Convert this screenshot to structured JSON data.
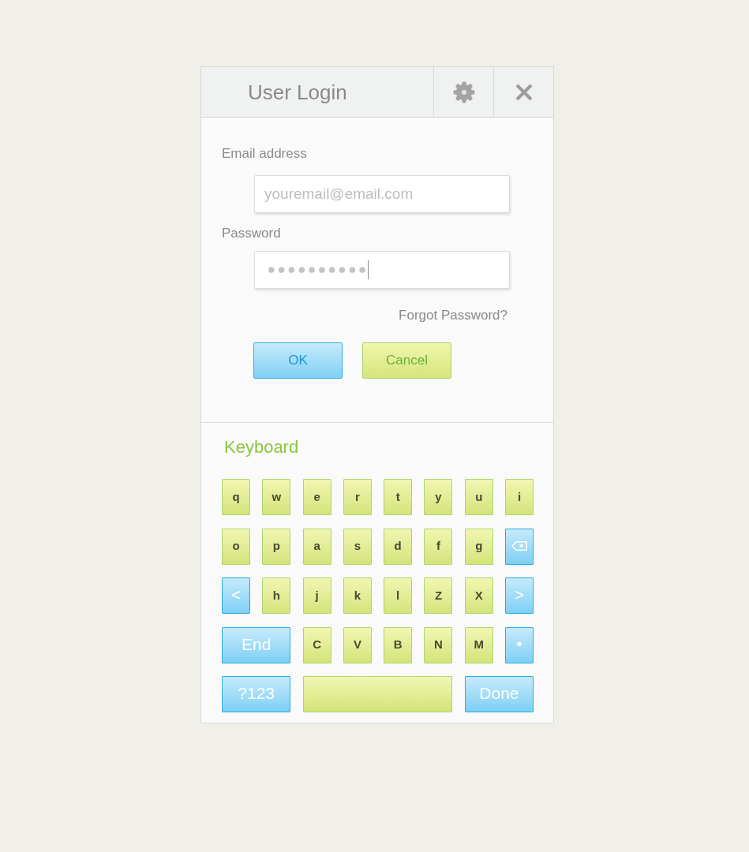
{
  "window": {
    "title": "User Login"
  },
  "form": {
    "email": {
      "label": "Email address",
      "placeholder": "youremail@email.com"
    },
    "password": {
      "label": "Password",
      "value": "••••••••••",
      "focused": true
    },
    "forgot_link": "Forgot Password?",
    "buttons": [
      {
        "label": "OK",
        "kind": "primary"
      },
      {
        "label": "Cancel",
        "kind": "secondary"
      }
    ]
  },
  "keyboard": {
    "title": "Keyboard",
    "keys": [
      {
        "label": "q",
        "kind": "letter"
      },
      {
        "label": "w",
        "kind": "letter"
      },
      {
        "label": "e",
        "kind": "letter"
      },
      {
        "label": "r",
        "kind": "letter"
      },
      {
        "label": "t",
        "kind": "letter"
      },
      {
        "label": "y",
        "kind": "letter"
      },
      {
        "label": "u",
        "kind": "letter"
      },
      {
        "label": "i",
        "kind": "letter"
      },
      {
        "label": "o",
        "kind": "letter"
      },
      {
        "label": "p",
        "kind": "letter"
      },
      {
        "label": "a",
        "kind": "letter"
      },
      {
        "label": "s",
        "kind": "letter"
      },
      {
        "label": "d",
        "kind": "letter"
      },
      {
        "label": "f",
        "kind": "letter"
      },
      {
        "label": "g",
        "kind": "letter"
      },
      {
        "kind": "backspace"
      },
      {
        "label": "<",
        "kind": "nav"
      },
      {
        "label": "h",
        "kind": "letter"
      },
      {
        "label": "j",
        "kind": "letter"
      },
      {
        "label": "k",
        "kind": "letter"
      },
      {
        "label": "l",
        "kind": "letter"
      },
      {
        "label": "Z",
        "kind": "letter"
      },
      {
        "label": "X",
        "kind": "letter"
      },
      {
        "label": ">",
        "kind": "nav"
      },
      {
        "label": "End",
        "kind": "wide"
      },
      {
        "label": "C",
        "kind": "letter"
      },
      {
        "label": "V",
        "kind": "letter"
      },
      {
        "label": "B",
        "kind": "letter"
      },
      {
        "label": "N",
        "kind": "letter"
      },
      {
        "label": "M",
        "kind": "letter"
      },
      {
        "label": "•",
        "kind": "nav"
      },
      {
        "label": "?123",
        "kind": "wide"
      },
      {
        "kind": "space"
      },
      {
        "label": "Done",
        "kind": "wide"
      }
    ]
  }
}
